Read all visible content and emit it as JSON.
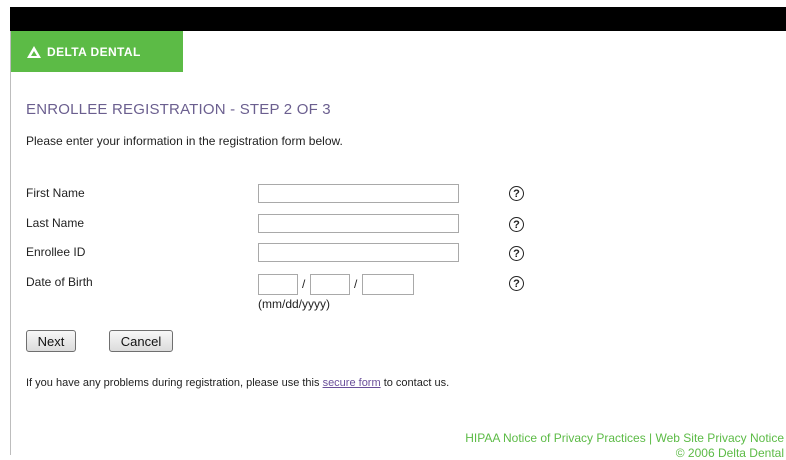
{
  "brand": {
    "logo_text": "DELTA DENTAL",
    "color": "#5cbb46"
  },
  "page": {
    "title": "ENROLLEE REGISTRATION - STEP 2 OF 3",
    "intro": "Please enter your information in the registration form below."
  },
  "form": {
    "first_name_label": "First Name",
    "last_name_label": "Last Name",
    "enrollee_id_label": "Enrollee ID",
    "dob_label": "Date of Birth",
    "first_name_value": "",
    "last_name_value": "",
    "enrollee_id_value": "",
    "dob_month_value": "",
    "dob_day_value": "",
    "dob_year_value": "",
    "dob_separator": "/",
    "dob_hint": "(mm/dd/yyyy)",
    "help_glyph": "?"
  },
  "buttons": {
    "next": "Next",
    "cancel": "Cancel"
  },
  "help_line": {
    "before": "If you have any problems during registration, please use this ",
    "link": "secure form",
    "after": " to contact us."
  },
  "footer": {
    "links": "HIPAA Notice of Privacy Practices | Web Site Privacy Notice",
    "copyright": "© 2006 Delta Dental"
  }
}
